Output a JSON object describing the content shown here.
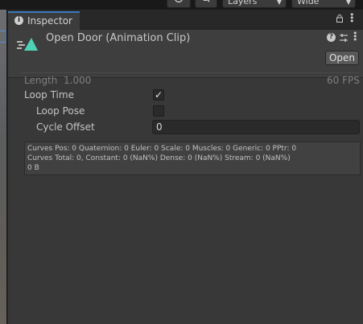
{
  "toolbar": {
    "layers_label": "Layers",
    "layout_label": "Wide"
  },
  "inspector": {
    "tab_label": "Inspector"
  },
  "asset": {
    "title": "Open Door (Animation Clip)",
    "open_label": "Open",
    "icon_color": "#4fd1b8"
  },
  "clip": {
    "length_label": "Length",
    "length_value": "1.000",
    "fps_label": "60 FPS",
    "loop_time_label": "Loop Time",
    "loop_time_checked": true,
    "loop_pose_label": "Loop Pose",
    "loop_pose_checked": false,
    "cycle_offset_label": "Cycle Offset",
    "cycle_offset_value": "0"
  },
  "info": {
    "line1": "Curves Pos: 0 Quaternion: 0 Euler: 0 Scale: 0 Muscles: 0 Generic: 0 PPtr: 0",
    "line2": "Curves Total: 0, Constant: 0 (NaN%) Dense: 0 (NaN%) Stream: 0 (NaN%)",
    "line3": "0 B"
  }
}
